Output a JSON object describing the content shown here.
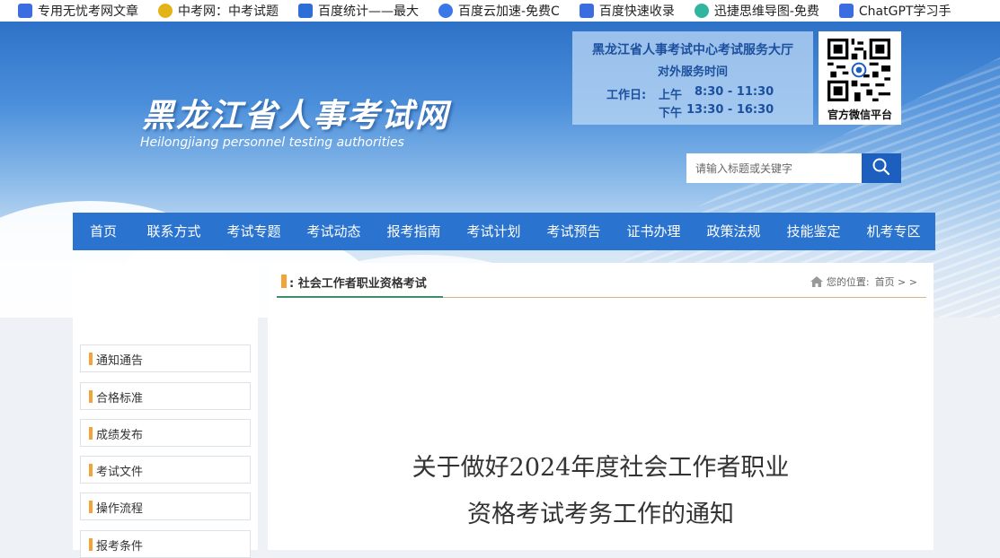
{
  "bookmarks": [
    {
      "label": "专用无忧考网文章",
      "icon": "doc-icon"
    },
    {
      "label": "中考网：中考试题",
      "icon": "gold-logo-icon"
    },
    {
      "label": "百度统计——最大",
      "icon": "baidu-stats-icon"
    },
    {
      "label": "百度云加速-免费C",
      "icon": "cloud-icon"
    },
    {
      "label": "百度快速收录",
      "icon": "doc-icon"
    },
    {
      "label": "迅捷思维导图-免费",
      "icon": "mindmap-icon"
    },
    {
      "label": "ChatGPT学习手",
      "icon": "doc-icon"
    }
  ],
  "header": {
    "title": "黑龙江省人事考试网",
    "subtitle": "Heilongjiang personnel testing authorities",
    "service": {
      "line1": "黑龙江省人事考试中心考试服务大厅",
      "line2": "对外服务时间",
      "workday_label": "工作日:",
      "am_label": "上午",
      "am_time": "8:30 - 11:30",
      "pm_label": "下午",
      "pm_time": "13:30 - 16:30"
    },
    "qr_caption": "官方微信平台"
  },
  "search": {
    "placeholder": "请输入标题或关键字"
  },
  "nav": [
    "首页",
    "联系方式",
    "考试专题",
    "考试动态",
    "报考指南",
    "考试计划",
    "考试预告",
    "证书办理",
    "政策法规",
    "技能鉴定",
    "机考专区"
  ],
  "sidebar": [
    "通知通告",
    "合格标准",
    "成绩发布",
    "考试文件",
    "操作流程",
    "报考条件"
  ],
  "main": {
    "category": ": 社会工作者职业资格考试",
    "location_label": "您的位置:",
    "location_path": "首页 > >",
    "article_title_line1": "关于做好2024年度社会工作者职业",
    "article_title_line2": "资格考试考务工作的通知"
  },
  "colors": {
    "nav_bg": "#2a73cf",
    "accent_orange": "#f3a33a",
    "search_btn": "#1d5fbf"
  }
}
